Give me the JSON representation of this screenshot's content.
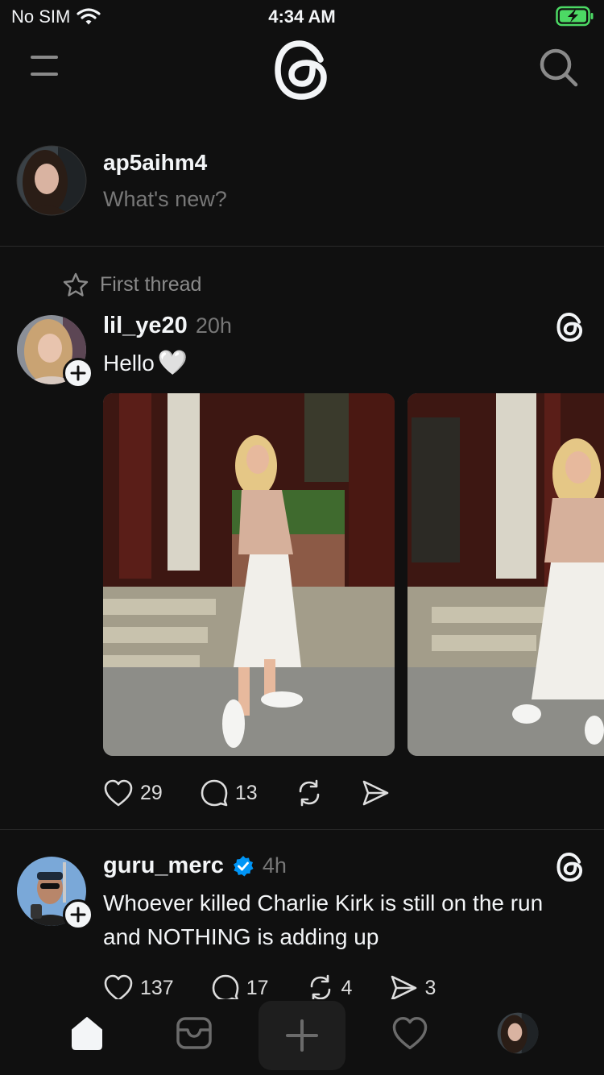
{
  "status_bar": {
    "carrier": "No SIM",
    "time": "4:34 AM",
    "wifi_icon": "wifi-icon",
    "battery_icon": "battery-charging-icon",
    "battery_color": "#4cd964"
  },
  "header": {
    "menu_icon": "menu-icon",
    "logo": "threads-logo",
    "search_icon": "search-icon"
  },
  "composer": {
    "username": "ap5aihm4",
    "placeholder": "What's new?"
  },
  "posts": [
    {
      "label": "First thread",
      "username": "lil_ye20",
      "time": "20h",
      "text": "Hello",
      "emoji": "🤍",
      "photos": 2,
      "likes": "29",
      "replies": "13",
      "reposts": "",
      "shares": ""
    },
    {
      "username": "guru_merc",
      "verified": true,
      "time": "4h",
      "text": "Whoever killed Charlie Kirk is still on the run and NOTHING is adding up",
      "likes": "137",
      "replies": "17",
      "reposts": "4",
      "shares": "3"
    }
  ],
  "tab_bar": {
    "tabs": [
      "home-icon",
      "inbox-icon",
      "create-icon",
      "heart-icon",
      "profile-avatar"
    ]
  },
  "colors": {
    "background": "#101010",
    "text": "#f3f5f7",
    "muted": "#777777",
    "verified": "#0095f6"
  }
}
